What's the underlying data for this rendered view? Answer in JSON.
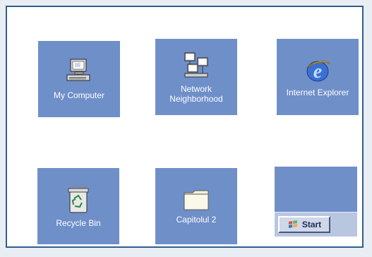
{
  "desktop": {
    "icons": [
      {
        "label": "My Computer",
        "icon": "computer-icon"
      },
      {
        "label": "Network Neighborhood",
        "icon": "network-icon"
      },
      {
        "label": "Internet Explorer",
        "icon": "internet-explorer-icon"
      },
      {
        "label": "Recycle Bin",
        "icon": "recycle-bin-icon"
      },
      {
        "label": "Capitolul 2",
        "icon": "folder-icon"
      }
    ]
  },
  "taskbar": {
    "start_label": "Start",
    "start_icon": "windows-logo-icon"
  },
  "colors": {
    "tile": "#6f8fc9",
    "border": "#2f5f8c",
    "taskbar": "#b9c6e0"
  }
}
